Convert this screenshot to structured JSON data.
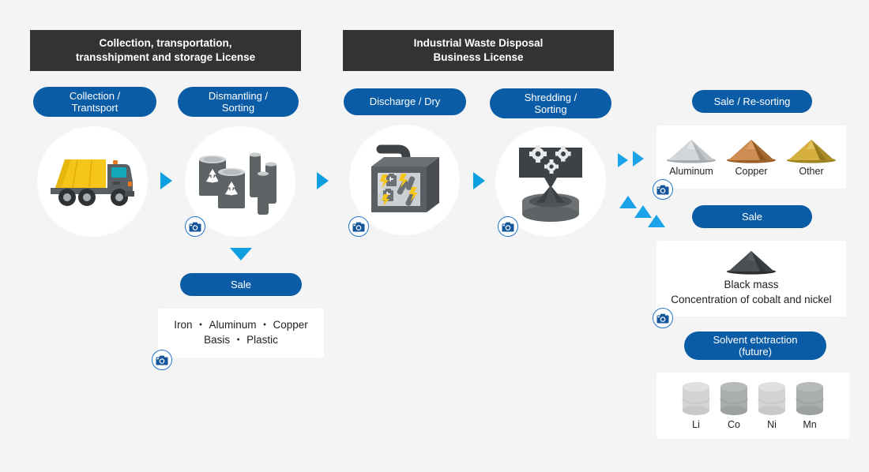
{
  "licenses": [
    {
      "id": "collection-license",
      "line1": "Collection, transportation,",
      "line2": "transshipment and storage License"
    },
    {
      "id": "industrial-license",
      "line1": "Industrial Waste Disposal",
      "line2": "Business License"
    }
  ],
  "steps": [
    {
      "id": "collection",
      "line1": "Collection /",
      "line2": "Trantsport",
      "icon": "garbage-truck-icon"
    },
    {
      "id": "dismantling",
      "line1": "Dismantling /",
      "line2": "Sorting",
      "icon": "recycle-barrels-batteries-icon"
    },
    {
      "id": "discharge",
      "line1": "Discharge / Dry",
      "line2": "",
      "icon": "discharge-machine-icon"
    },
    {
      "id": "shredding",
      "line1": "Shredding /",
      "line2": "Sorting",
      "icon": "shredder-funnel-gears-icon"
    }
  ],
  "left_outcome": {
    "sale_label": "Sale",
    "materials_line1": "Iron ・ Aluminum ・ Copper",
    "materials_line2": "Basis ・ Plastic"
  },
  "right_column": {
    "resorting": {
      "pill_label": "Sale / Re-sorting",
      "powders": [
        {
          "label": "Aluminum",
          "color": "#b9bcbe",
          "color_dark": "#9fa3a6"
        },
        {
          "label": "Copper",
          "color": "#cf8c52",
          "color_dark": "#a9682f"
        },
        {
          "label": "Other",
          "color": "#d6b03e",
          "color_dark": "#ab8b26"
        }
      ]
    },
    "black_mass": {
      "pill_label": "Sale",
      "title": "Black mass",
      "subtitle": "Concentration of cobalt and nickel",
      "color": "#3d4246",
      "color_dark": "#2b3033"
    },
    "solvent": {
      "pill_line1": "Solvent etxtraction",
      "pill_line2": "(future)",
      "metals": [
        {
          "label": "Li",
          "color": "#d2d5d4",
          "top": "#dfe1e0"
        },
        {
          "label": "Co",
          "color": "#a9adac",
          "top": "#b6bab9"
        },
        {
          "label": "Ni",
          "color": "#d2d5d4",
          "top": "#dfe1e0"
        },
        {
          "label": "Mn",
          "color": "#a9adac",
          "top": "#b6bab9"
        }
      ]
    }
  },
  "icons": {
    "camera": "camera-icon",
    "arrow_right": "arrow-right-icon",
    "arrow_down": "arrow-down-icon",
    "arrow_up": "arrow-up-icon"
  },
  "colors": {
    "background": "#f4f4f4",
    "license_bar": "#333333",
    "pill_blue": "#0b5ca6",
    "arrow_blue": "#0e9fe0",
    "camera_blue": "#2277c8",
    "card_white": "#ffffff"
  }
}
